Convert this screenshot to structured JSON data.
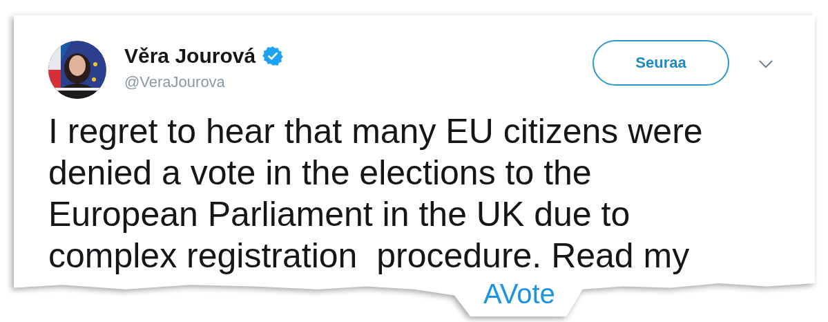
{
  "tweet": {
    "author": {
      "name": "Věra Jourová",
      "verified": true,
      "handle": "@VeraJourova"
    },
    "follow_button": "Seuraa",
    "text": "I regret to hear that many EU citizens were denied a vote in the elections to the European Parliament in the UK due to complex registration  procedure. Read my",
    "link_fragment": "AVote"
  }
}
